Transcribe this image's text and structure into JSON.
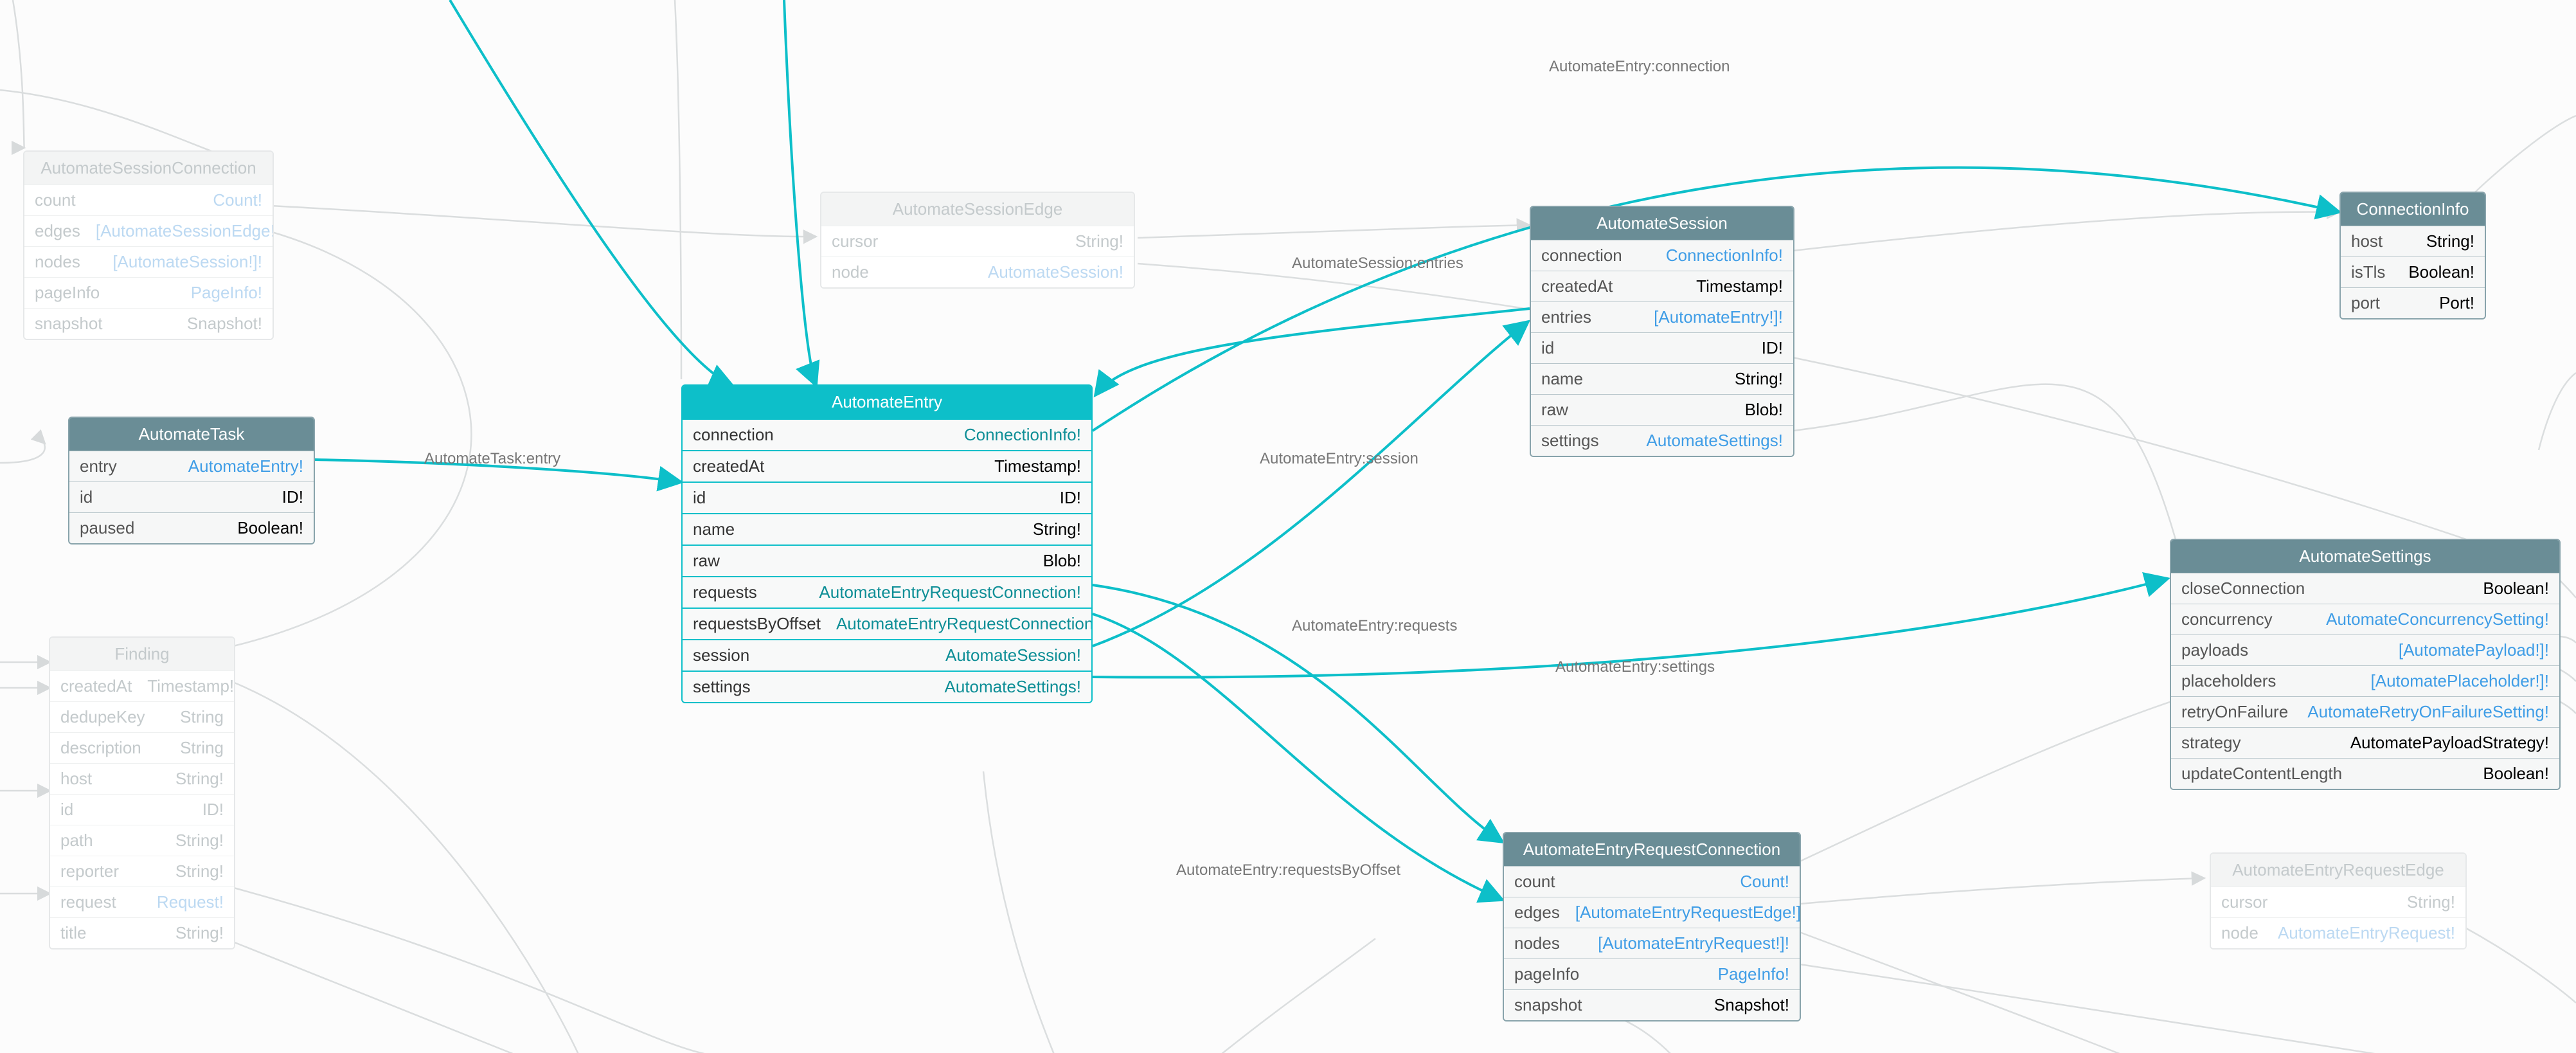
{
  "domain": "Diagram",
  "layout": "GraphQL schema / type relationship diagram",
  "focus_node": "AutomateEntry",
  "colors": {
    "focus": "#0dbfc9",
    "secondary": "#6a8d96",
    "tertiary_text": "#c4cacc",
    "link_primary": "#0d8e96",
    "link_secondary": "#3f9de6"
  },
  "edge_labels": {
    "connection": "AutomateEntry:connection",
    "session_entries": "AutomateSession:entries",
    "task_entry": "AutomateTask:entry",
    "session": "AutomateEntry:session",
    "settings": "AutomateEntry:settings",
    "requests": "AutomateEntry:requests",
    "requestsByOffset": "AutomateEntry:requestsByOffset"
  },
  "nodes": {
    "AutomateEntry": {
      "title": "AutomateEntry",
      "fields": [
        {
          "name": "connection",
          "type": "ConnectionInfo!",
          "link": true
        },
        {
          "name": "createdAt",
          "type": "Timestamp!",
          "link": false
        },
        {
          "name": "id",
          "type": "ID!",
          "link": false
        },
        {
          "name": "name",
          "type": "String!",
          "link": false
        },
        {
          "name": "raw",
          "type": "Blob!",
          "link": false
        },
        {
          "name": "requests",
          "type": "AutomateEntryRequestConnection!",
          "link": true
        },
        {
          "name": "requestsByOffset",
          "type": "AutomateEntryRequestConnection!",
          "link": true
        },
        {
          "name": "session",
          "type": "AutomateSession!",
          "link": true
        },
        {
          "name": "settings",
          "type": "AutomateSettings!",
          "link": true
        }
      ]
    },
    "AutomateTask": {
      "title": "AutomateTask",
      "fields": [
        {
          "name": "entry",
          "type": "AutomateEntry!",
          "link": true
        },
        {
          "name": "id",
          "type": "ID!",
          "link": false
        },
        {
          "name": "paused",
          "type": "Boolean!",
          "link": false
        }
      ]
    },
    "AutomateSession": {
      "title": "AutomateSession",
      "fields": [
        {
          "name": "connection",
          "type": "ConnectionInfo!",
          "link": true
        },
        {
          "name": "createdAt",
          "type": "Timestamp!",
          "link": false
        },
        {
          "name": "entries",
          "type": "[AutomateEntry!]!",
          "link": true
        },
        {
          "name": "id",
          "type": "ID!",
          "link": false
        },
        {
          "name": "name",
          "type": "String!",
          "link": false
        },
        {
          "name": "raw",
          "type": "Blob!",
          "link": false
        },
        {
          "name": "settings",
          "type": "AutomateSettings!",
          "link": true
        }
      ]
    },
    "ConnectionInfo": {
      "title": "ConnectionInfo",
      "fields": [
        {
          "name": "host",
          "type": "String!",
          "link": false
        },
        {
          "name": "isTls",
          "type": "Boolean!",
          "link": false
        },
        {
          "name": "port",
          "type": "Port!",
          "link": false
        }
      ]
    },
    "AutomateSettings": {
      "title": "AutomateSettings",
      "fields": [
        {
          "name": "closeConnection",
          "type": "Boolean!",
          "link": false
        },
        {
          "name": "concurrency",
          "type": "AutomateConcurrencySetting!",
          "link": true
        },
        {
          "name": "payloads",
          "type": "[AutomatePayload!]!",
          "link": true
        },
        {
          "name": "placeholders",
          "type": "[AutomatePlaceholder!]!",
          "link": true
        },
        {
          "name": "retryOnFailure",
          "type": "AutomateRetryOnFailureSetting!",
          "link": true
        },
        {
          "name": "strategy",
          "type": "AutomatePayloadStrategy!",
          "link": false
        },
        {
          "name": "updateContentLength",
          "type": "Boolean!",
          "link": false
        }
      ]
    },
    "AutomateEntryRequestConnection": {
      "title": "AutomateEntryRequestConnection",
      "fields": [
        {
          "name": "count",
          "type": "Count!",
          "link": true
        },
        {
          "name": "edges",
          "type": "[AutomateEntryRequestEdge!]!",
          "link": true
        },
        {
          "name": "nodes",
          "type": "[AutomateEntryRequest!]!",
          "link": true
        },
        {
          "name": "pageInfo",
          "type": "PageInfo!",
          "link": true
        },
        {
          "name": "snapshot",
          "type": "Snapshot!",
          "link": false
        }
      ]
    },
    "AutomateSessionConnection": {
      "title": "AutomateSessionConnection",
      "fields": [
        {
          "name": "count",
          "type": "Count!",
          "link": true
        },
        {
          "name": "edges",
          "type": "[AutomateSessionEdge!]!",
          "link": true
        },
        {
          "name": "nodes",
          "type": "[AutomateSession!]!",
          "link": true
        },
        {
          "name": "pageInfo",
          "type": "PageInfo!",
          "link": true
        },
        {
          "name": "snapshot",
          "type": "Snapshot!",
          "link": false
        }
      ]
    },
    "AutomateSessionEdge": {
      "title": "AutomateSessionEdge",
      "fields": [
        {
          "name": "cursor",
          "type": "String!",
          "link": false
        },
        {
          "name": "node",
          "type": "AutomateSession!",
          "link": true
        }
      ]
    },
    "Finding": {
      "title": "Finding",
      "fields": [
        {
          "name": "createdAt",
          "type": "Timestamp!",
          "link": false
        },
        {
          "name": "dedupeKey",
          "type": "String",
          "link": false
        },
        {
          "name": "description",
          "type": "String",
          "link": false
        },
        {
          "name": "host",
          "type": "String!",
          "link": false
        },
        {
          "name": "id",
          "type": "ID!",
          "link": false
        },
        {
          "name": "path",
          "type": "String!",
          "link": false
        },
        {
          "name": "reporter",
          "type": "String!",
          "link": false
        },
        {
          "name": "request",
          "type": "Request!",
          "link": true
        },
        {
          "name": "title",
          "type": "String!",
          "link": false
        }
      ]
    },
    "AutomateEntryRequestEdge": {
      "title": "AutomateEntryRequestEdge",
      "fields": [
        {
          "name": "cursor",
          "type": "String!",
          "link": false
        },
        {
          "name": "node",
          "type": "AutomateEntryRequest!",
          "link": true
        }
      ]
    }
  },
  "chart_data": {
    "type": "graph",
    "description": "GraphQL type relationship diagram centered on AutomateEntry",
    "nodes": [
      "AutomateEntry",
      "AutomateTask",
      "AutomateSession",
      "ConnectionInfo",
      "AutomateSettings",
      "AutomateEntryRequestConnection",
      "AutomateSessionConnection",
      "AutomateSessionEdge",
      "Finding",
      "AutomateEntryRequestEdge"
    ],
    "edges_highlighted": [
      {
        "from": "AutomateTask",
        "field": "entry",
        "to": "AutomateEntry",
        "label": "AutomateTask:entry"
      },
      {
        "from": "AutomateSession",
        "field": "entries",
        "to": "AutomateEntry",
        "label": "AutomateSession:entries"
      },
      {
        "from": "AutomateEntry",
        "field": "connection",
        "to": "ConnectionInfo",
        "label": "AutomateEntry:connection"
      },
      {
        "from": "AutomateEntry",
        "field": "session",
        "to": "AutomateSession",
        "label": "AutomateEntry:session"
      },
      {
        "from": "AutomateEntry",
        "field": "settings",
        "to": "AutomateSettings",
        "label": "AutomateEntry:settings"
      },
      {
        "from": "AutomateEntry",
        "field": "requests",
        "to": "AutomateEntryRequestConnection",
        "label": "AutomateEntry:requests"
      },
      {
        "from": "AutomateEntry",
        "field": "requestsByOffset",
        "to": "AutomateEntryRequestConnection",
        "label": "AutomateEntry:requestsByOffset"
      }
    ]
  }
}
